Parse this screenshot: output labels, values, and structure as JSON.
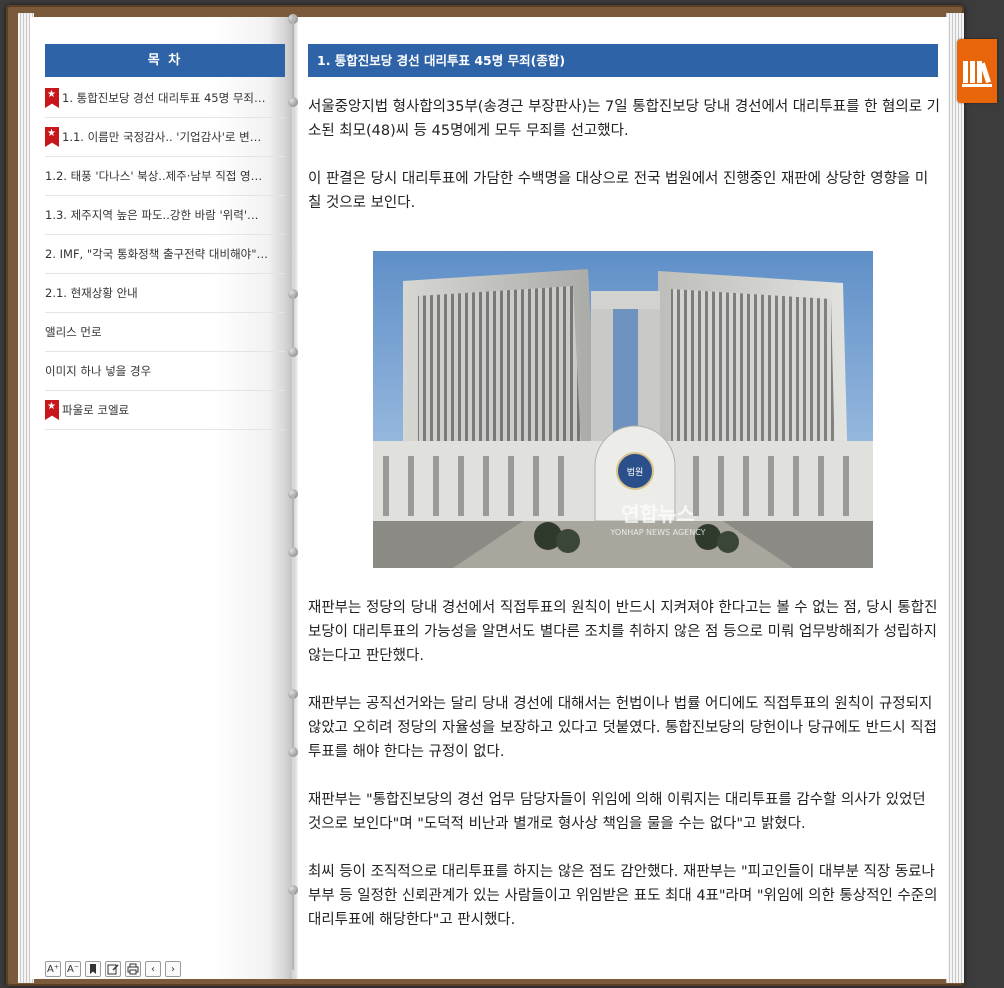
{
  "toc": {
    "header": "목 차",
    "items": [
      {
        "label": "1. 통합진보당 경선 대리투표 45명 무죄…",
        "bookmark": true
      },
      {
        "label": "1.1. 이름만 국정감사.. '기업감사'로 변…",
        "bookmark": true
      },
      {
        "label": "1.2. 태풍 '다나스' 북상..제주·남부 직접 영…",
        "bookmark": false
      },
      {
        "label": "1.3. 제주지역 높은 파도..강한 바람 '위력'…",
        "bookmark": false
      },
      {
        "label": "2. IMF, \"각국 통화정책 출구전략 대비해야\"…",
        "bookmark": false
      },
      {
        "label": "2.1. 현재상황 안내",
        "bookmark": false
      },
      {
        "label": "앨리스 먼로",
        "bookmark": false
      },
      {
        "label": "이미지 하나 넣을 경우",
        "bookmark": false
      },
      {
        "label": "파울로 코엘료",
        "bookmark": true
      }
    ]
  },
  "toolbar": {
    "font_increase": "A⁺",
    "font_decrease": "A⁻",
    "bookmark": "bookmark-icon",
    "memo": "memo-icon",
    "print": "print-icon",
    "prev": "‹",
    "next": "›"
  },
  "article": {
    "title": "1. 통합진보당 경선 대리투표 45명 무죄(종합)",
    "paragraphs": [
      "서울중앙지법 형사합의35부(송경근 부장판사)는 7일 통합진보당 당내 경선에서 대리투표를 한 혐의로 기소된 최모(48)씨 등 45명에게 모두 무죄를 선고했다.",
      "이 판결은 당시 대리투표에 가담한 수백명을 대상으로 전국 법원에서 진행중인 재판에 상당한 영향을 미칠 것으로 보인다."
    ],
    "paragraphs_after_image": [
      "재판부는 정당의 당내 경선에서 직접투표의 원칙이 반드시 지켜져야 한다고는 볼 수 없는 점, 당시 통합진보당이 대리투표의 가능성을 알면서도 별다른 조치를 취하지 않은 점 등으로 미뤄 업무방해죄가 성립하지 않는다고 판단했다.",
      "재판부는 공직선거와는 달리 당내 경선에 대해서는 헌법이나 법률 어디에도 직접투표의 원칙이 규정되지 않았고 오히려 정당의 자율성을 보장하고 있다고 덧붙였다. 통합진보당의 당헌이나 당규에도 반드시 직접투표를 해야 한다는 규정이 없다.",
      "재판부는 \"통합진보당의 경선 업무 담당자들이 위임에 의해 이뤄지는 대리투표를 감수할 의사가 있었던 것으로 보인다\"며 \"도덕적 비난과 별개로 형사상 책임을 물을 수는 없다\"고 밝혔다.",
      "최씨 등이 조직적으로 대리투표를 하지는 않은 점도 감안했다. 재판부는 \"피고인들이 대부분 직장 동료나 부부 등 일정한 신뢰관계가 있는 사람들이고 위임받은 표도 최대 4표\"라며 \"위임에 의한 통상적인 수준의 대리투표에 해당한다\"고 판시했다."
    ],
    "image": {
      "watermark": "연합뉴스",
      "watermark_sub": "YONHAP NEWS AGENCY",
      "emblem": "법원"
    }
  },
  "side_tab": {
    "icon": "library-icon"
  },
  "colors": {
    "accent": "#2e63a8",
    "side_tab": "#e8650a",
    "bookmark": "#c8161d"
  }
}
